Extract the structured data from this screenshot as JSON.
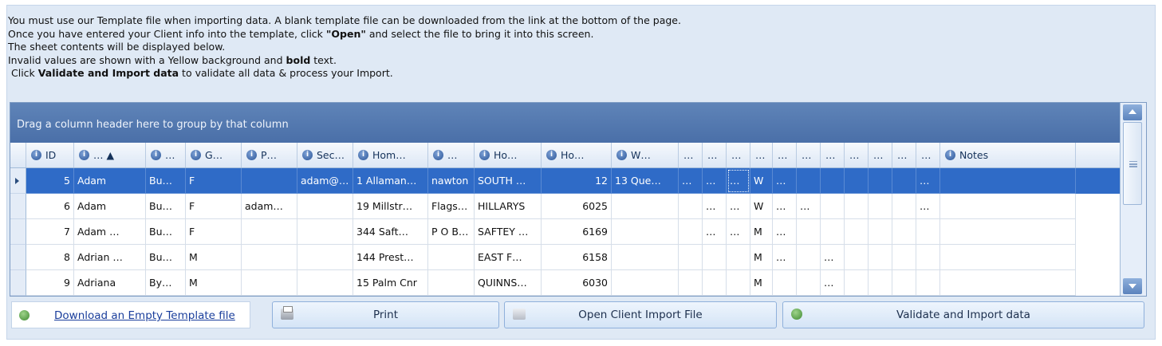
{
  "instructions": {
    "line1": "You must use our Template file when importing data. A blank template file can be downloaded from the link at the bottom of the page.",
    "line2_a": "Once you have entered your Client info into the template, click ",
    "line2_b": "\"Open\"",
    "line2_c": " and select the file to bring it into this screen.",
    "line3": "The sheet contents will be displayed below.",
    "line4_a": "Invalid values are shown with a Yellow background and ",
    "line4_b": "bold",
    "line4_c": " text.",
    "line5_a": "Click ",
    "line5_b": "Validate and Import data",
    "line5_c": " to validate all data & process your Import."
  },
  "grid": {
    "group_panel_text": "Drag a column header here to group by that column",
    "columns": [
      "ID",
      "… ▲",
      "…",
      "G…",
      "P…",
      "Sec…",
      "Hom…",
      "…",
      "Ho…",
      "Ho…",
      "W…",
      "…",
      "…",
      "…",
      "…",
      "…",
      "…",
      "…",
      "…",
      "…",
      "…",
      "…",
      "Notes"
    ],
    "rows": [
      [
        "5",
        "Adam",
        "Bu…",
        "F",
        "",
        "adam@…",
        "1 Allaman…",
        "nawton",
        "SOUTH …",
        "12",
        "13 Que…",
        "…",
        "…",
        "…",
        "W",
        "…",
        "",
        "",
        "",
        "",
        "",
        "…",
        ""
      ],
      [
        "6",
        "Adam",
        "Bu…",
        "F",
        "adam…",
        "",
        "19 Millstr…",
        "Flags…",
        "HILLARYS",
        "6025",
        "",
        "",
        "…",
        "…",
        "W",
        "…",
        "…",
        "",
        "",
        "",
        "",
        "…",
        ""
      ],
      [
        "7",
        "Adam …",
        "Bu…",
        "F",
        "",
        "",
        "344 Saft…",
        "P O B…",
        "SAFTEY …",
        "6169",
        "",
        "",
        "…",
        "…",
        "M",
        "…",
        "",
        "",
        "",
        "",
        "",
        "",
        ""
      ],
      [
        "8",
        "Adrian …",
        "Bu…",
        "M",
        "",
        "",
        "144 Prest…",
        "",
        "EAST F…",
        "6158",
        "",
        "",
        "",
        "",
        "M",
        "…",
        "",
        "…",
        "",
        "",
        "",
        "",
        ""
      ],
      [
        "9",
        "Adriana",
        "By…",
        "M",
        "",
        "",
        "15 Palm Cnr",
        "",
        "QUINNS…",
        "6030",
        "",
        "",
        "",
        "",
        "M",
        "",
        "",
        "…",
        "",
        "",
        "",
        "",
        ""
      ]
    ],
    "selected_row": 0
  },
  "actions": {
    "download_link": "Download an Empty Template file",
    "print": "Print",
    "open": "Open Client Import File",
    "validate": "Validate and Import data"
  },
  "colors": {
    "selection": "#2f6bc7",
    "group_panel": "#5376ad",
    "background": "#dfe9f5"
  }
}
